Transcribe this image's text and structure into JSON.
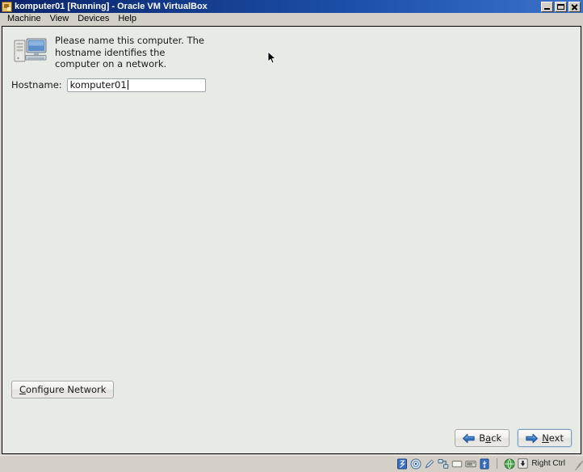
{
  "window": {
    "title": "komputer01 [Running] - Oracle VM VirtualBox",
    "icon": "virtualbox-icon",
    "controls": {
      "minimize": "Minimize",
      "maximize": "Maximize",
      "close": "Close"
    }
  },
  "menubar": {
    "items": [
      {
        "label": "Machine"
      },
      {
        "label": "View"
      },
      {
        "label": "Devices"
      },
      {
        "label": "Help"
      }
    ]
  },
  "installer": {
    "icon": "computer-network-icon",
    "hint": "Please name this computer.  The hostname identifies the computer on a network.",
    "hostname_label": "Hostname:",
    "hostname_value": "komputer01",
    "hostname_placeholder": "",
    "configure_button": {
      "accel": "C",
      "rest": "onfigure Network"
    },
    "back_button": {
      "pre": "B",
      "accel": "a",
      "rest": "ck",
      "icon": "arrow-left-icon"
    },
    "next_button": {
      "pre": "",
      "accel": "N",
      "rest": "ext",
      "icon": "arrow-right-icon"
    }
  },
  "statusbar": {
    "icons": [
      {
        "name": "hard-disk-icon",
        "title": "Hard Disks"
      },
      {
        "name": "optical-disk-icon",
        "title": "CD/DVD Devices"
      },
      {
        "name": "floppy-disk-icon",
        "title": "Floppy Devices"
      },
      {
        "name": "network-icon",
        "title": "Network Adapters"
      },
      {
        "name": "shared-folder-icon",
        "title": "Shared Folders"
      },
      {
        "name": "display-icon",
        "title": "Display"
      },
      {
        "name": "usb-icon",
        "title": "USB Devices"
      }
    ],
    "globe_icon": "remote-desktop-icon",
    "hostkey_icon": "host-key-icon",
    "hostkey_label": "Right Ctrl"
  },
  "colors": {
    "titlebar_start": "#0a246a",
    "titlebar_end": "#3b72c9",
    "chrome": "#d4d0c8",
    "vm_background": "#e8eae5",
    "accent_blue": "#2a62b4"
  }
}
